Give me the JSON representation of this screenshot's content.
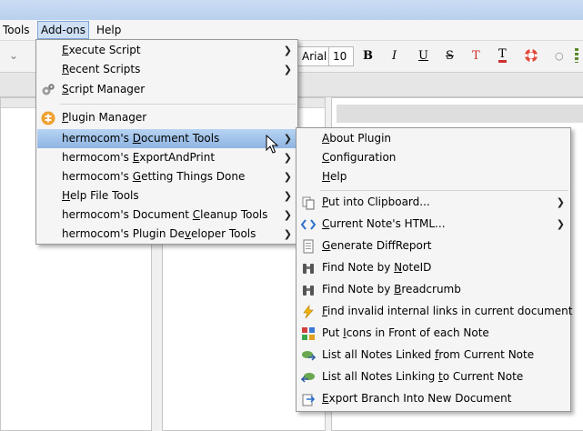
{
  "menubar": {
    "tools": "Tools",
    "addons": "Add-ons",
    "help": "Help"
  },
  "toolbar": {
    "font_name": "Arial",
    "font_size": "10",
    "bold": "B",
    "italic": "I",
    "underline": "U",
    "strike": "S",
    "color": "T",
    "highlight": "T"
  },
  "addons_menu": {
    "items": [
      {
        "label": "Execute Script",
        "u": "E",
        "rest": "xecute Script"
      },
      {
        "label": "Recent Scripts",
        "u": "R",
        "rest": "ecent Scripts"
      },
      {
        "label": "Script Manager",
        "u": "S",
        "rest": "cript Manager"
      },
      {
        "label": "Plugin Manager",
        "u": "P",
        "rest": "lugin Manager"
      },
      {
        "label": "hermocom's Document Tools",
        "pre": "hermocom's ",
        "u": "D",
        "rest": "ocument Tools"
      },
      {
        "label": "hermocom's ExportAndPrint",
        "pre": "hermocom's ",
        "u": "E",
        "rest": "xportAndPrint"
      },
      {
        "label": "hermocom's Getting Things Done",
        "pre": "hermocom's ",
        "u": "G",
        "rest": "etting Things Done"
      },
      {
        "label": "Help File Tools",
        "pre": "",
        "u": "H",
        "rest": "elp File Tools"
      },
      {
        "label": "hermocom's Document Cleanup Tools",
        "pre": "hermocom's Document ",
        "u": "C",
        "rest": "leanup Tools"
      },
      {
        "label": "hermocom's Plugin Developer Tools",
        "pre": "hermocom's Plugin De",
        "u": "v",
        "rest": "eloper Tools"
      }
    ]
  },
  "doc_tools_menu": {
    "items": [
      {
        "pre": "",
        "u": "A",
        "rest": "bout Plugin"
      },
      {
        "pre": "",
        "u": "C",
        "rest": "onfiguration"
      },
      {
        "pre": "",
        "u": "H",
        "rest": "elp"
      },
      {
        "pre": "",
        "u": "P",
        "rest": "ut into Clipboard..."
      },
      {
        "pre": "",
        "u": "C",
        "rest": "urrent Note's HTML..."
      },
      {
        "pre": "",
        "u": "G",
        "rest": "enerate DiffReport"
      },
      {
        "pre": "Find Note by ",
        "u": "N",
        "rest": "oteID"
      },
      {
        "pre": "Find Note by ",
        "u": "B",
        "rest": "readcrumb"
      },
      {
        "pre": "",
        "u": "F",
        "rest": "ind invalid internal links in current document"
      },
      {
        "pre": "Put ",
        "u": "I",
        "rest": "cons in Front of each Note"
      },
      {
        "pre": "List all Notes Linked ",
        "u": "f",
        "rest": "rom Current Note"
      },
      {
        "pre": "List all Notes Linking ",
        "u": "t",
        "rest": "o Current Note"
      },
      {
        "pre": "",
        "u": "E",
        "rest": "xport Branch Into New Document"
      }
    ]
  },
  "colors": {
    "highlight_top": "#b7d3f2",
    "highlight_bottom": "#8fb5e3",
    "menu_bg": "#f5f5f5",
    "plugin_orange": "#f0a030"
  }
}
